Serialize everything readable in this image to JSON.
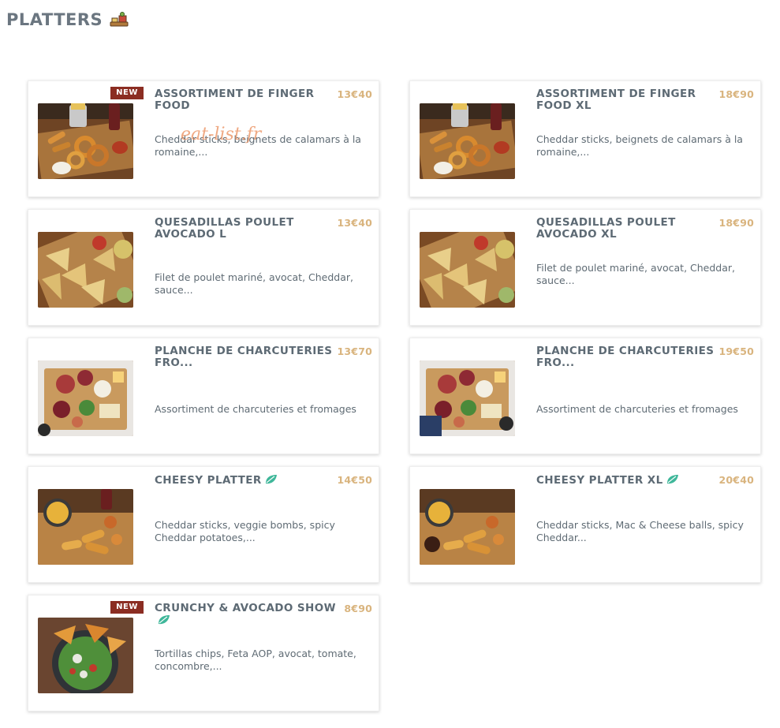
{
  "section": {
    "title": "PLATTERS",
    "icon": "platter-icon"
  },
  "watermark": "eat-list.fr",
  "items": [
    {
      "name": "ASSORTIMENT DE FINGER FOOD",
      "price": "13€40",
      "description": "Cheddar sticks, beignets de calamars à la romaine,...",
      "badge": "NEW",
      "vegetarian": false,
      "image": "finger-food"
    },
    {
      "name": "ASSORTIMENT DE FINGER FOOD XL",
      "price": "18€90",
      "description": "Cheddar sticks, beignets de calamars à la romaine,...",
      "badge": "",
      "vegetarian": false,
      "image": "finger-food"
    },
    {
      "name": "QUESADILLAS POULET AVOCADO L",
      "price": "13€40",
      "description": "Filet de poulet mariné, avocat, Cheddar, sauce...",
      "badge": "",
      "vegetarian": false,
      "image": "quesadillas"
    },
    {
      "name": "QUESADILLAS POULET AVOCADO XL",
      "price": "18€90",
      "description": "Filet de poulet mariné, avocat, Cheddar, sauce...",
      "badge": "",
      "vegetarian": false,
      "image": "quesadillas"
    },
    {
      "name": "PLANCHE DE CHARCUTERIES FRO...",
      "price": "13€70",
      "description": "Assortiment de charcuteries et fromages",
      "badge": "",
      "vegetarian": false,
      "image": "charcuterie"
    },
    {
      "name": "PLANCHE DE CHARCUTERIES FRO...",
      "price": "19€50",
      "description": "Assortiment de charcuteries et fromages",
      "badge": "",
      "vegetarian": false,
      "image": "charcuterie-xl"
    },
    {
      "name": "CHEESY PLATTER",
      "price": "14€50",
      "description": "Cheddar sticks, veggie bombs, spicy Cheddar potatoes,...",
      "badge": "",
      "vegetarian": true,
      "image": "cheesy"
    },
    {
      "name": "CHEESY PLATTER XL",
      "price": "20€40",
      "description": "Cheddar sticks, Mac & Cheese balls, spicy Cheddar...",
      "badge": "",
      "vegetarian": true,
      "image": "cheesy-xl"
    },
    {
      "name": "CRUNCHY & AVOCADO SHOW",
      "price": "8€90",
      "description": "Tortillas chips, Feta AOP, avocat, tomate, concombre,...",
      "badge": "NEW",
      "vegetarian": true,
      "image": "crunchy"
    }
  ],
  "colors": {
    "title": "#6b7680",
    "name": "#5d6a74",
    "price": "#d9b47e",
    "badge": "#8b2d22",
    "veg_leaf": "#3fb79a"
  }
}
